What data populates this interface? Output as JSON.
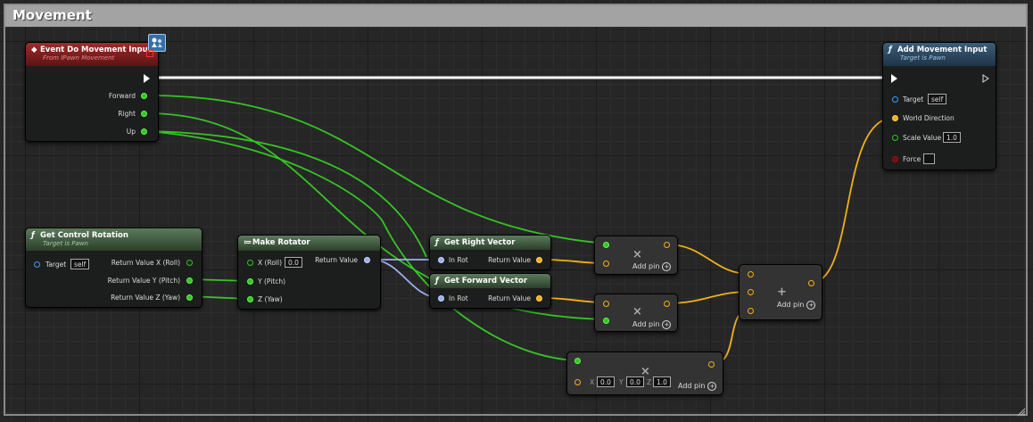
{
  "comment": {
    "title": "Movement"
  },
  "nodes": {
    "event_movement": {
      "title": "Event Do Movement Input",
      "subtitle": "From IPawn Movement",
      "pins": {
        "forward": "Forward",
        "right": "Right",
        "up": "Up"
      }
    },
    "add_movement": {
      "title": "Add Movement Input",
      "subtitle": "Target is Pawn",
      "pins": {
        "target": "Target",
        "target_value": "self",
        "world_direction": "World Direction",
        "scale_value": "Scale Value",
        "scale_value_val": "1.0",
        "force": "Force"
      }
    },
    "get_control_rotation": {
      "title": "Get Control Rotation",
      "subtitle": "Target is Pawn",
      "pins": {
        "target": "Target",
        "target_value": "self",
        "roll": "Return Value X (Roll)",
        "pitch": "Return Value Y (Pitch)",
        "yaw": "Return Value Z (Yaw)"
      }
    },
    "make_rotator": {
      "title": "Make Rotator",
      "pins": {
        "x": "X (Roll)",
        "x_value": "0.0",
        "y": "Y (Pitch)",
        "z": "Z (Yaw)",
        "return_value": "Return Value"
      }
    },
    "get_right_vector": {
      "title": "Get Right Vector",
      "pins": {
        "in_rot": "In Rot",
        "return_value": "Return Value"
      }
    },
    "get_forward_vector": {
      "title": "Get Forward Vector",
      "pins": {
        "in_rot": "In Rot",
        "return_value": "Return Value"
      }
    },
    "multiply_1": {
      "symbol": "×",
      "add_pin": "Add pin"
    },
    "multiply_2": {
      "symbol": "×",
      "add_pin": "Add pin"
    },
    "multiply_3": {
      "symbol": "×",
      "add_pin": "Add pin",
      "x_label": "X",
      "x_value": "0.0",
      "y_label": "Y",
      "y_value": "0.0",
      "z_label": "Z",
      "z_value": "1.0"
    },
    "add_node": {
      "symbol": "+",
      "add_pin": "Add pin"
    }
  },
  "colors": {
    "exec": "#ffffff",
    "float": "#35c425",
    "vector": "#f2b01a",
    "rotator": "#9ab0f0",
    "object": "#3aa0ff",
    "event_header": "#a12a2a",
    "pure_header": "#5b7a5b",
    "function_header": "#3b5e7a"
  },
  "icons": {
    "function": "function-icon",
    "make": "make-struct-icon",
    "event": "event-icon",
    "add_pin": "add-pin-plus-icon"
  }
}
